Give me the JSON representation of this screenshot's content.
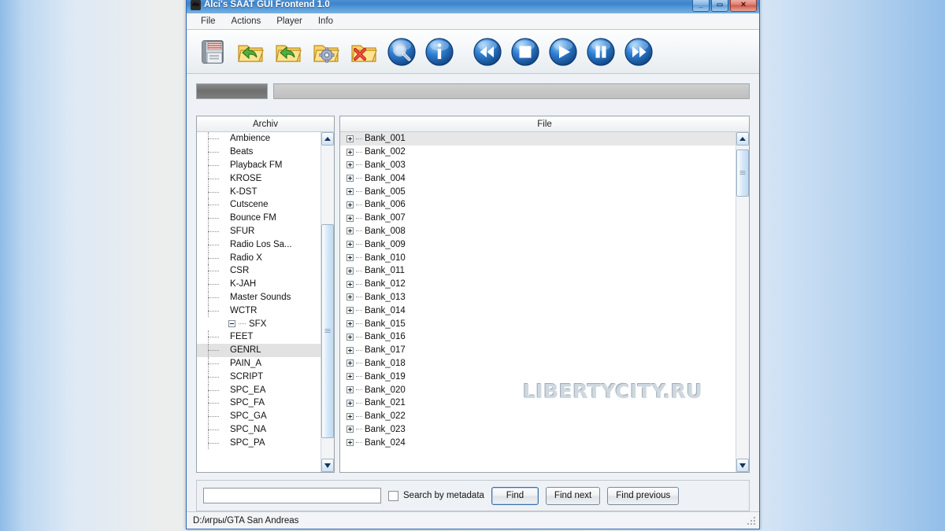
{
  "window": {
    "title": "Alci's SAAT GUI Frontend 1.0",
    "icon": "app-icon",
    "buttons": [
      {
        "name": "minimize",
        "glyph": "_"
      },
      {
        "name": "maximize",
        "glyph": "▭"
      },
      {
        "name": "close",
        "glyph": "✕"
      }
    ]
  },
  "menubar": {
    "items": [
      {
        "label": "File"
      },
      {
        "label": "Actions"
      },
      {
        "label": "Player"
      },
      {
        "label": "Info"
      }
    ]
  },
  "toolbar": {
    "buttons": [
      {
        "name": "save-button",
        "icon": "floppy-disk-icon",
        "tip": "Save"
      },
      {
        "name": "open-archive-button",
        "icon": "folder-open-icon",
        "tip": "Open archive"
      },
      {
        "name": "import-folder-button",
        "icon": "folder-import-icon",
        "tip": "Import folder"
      },
      {
        "name": "folder-settings-button",
        "icon": "folder-gear-icon",
        "tip": "Folder options"
      },
      {
        "name": "delete-folder-button",
        "icon": "folder-delete-icon",
        "tip": "Delete"
      },
      {
        "name": "search-button",
        "icon": "magnifier-icon",
        "tip": "Search"
      },
      {
        "name": "info-button",
        "icon": "info-icon",
        "tip": "Info"
      },
      {
        "name": "rewind-button",
        "icon": "rewind-icon",
        "tip": "Rewind"
      },
      {
        "name": "stop-button",
        "icon": "stop-icon",
        "tip": "Stop"
      },
      {
        "name": "play-button",
        "icon": "play-icon",
        "tip": "Play"
      },
      {
        "name": "pause-button",
        "icon": "pause-icon",
        "tip": "Pause"
      },
      {
        "name": "fastforward-button",
        "icon": "fast-forward-icon",
        "tip": "Fast forward"
      }
    ]
  },
  "progress": {
    "small": {
      "percent": 100
    },
    "large": {
      "percent": 100
    }
  },
  "tree": {
    "header": "Archiv",
    "selected": "GENRL",
    "items": [
      {
        "label": "Ambience",
        "level": 2,
        "type": "leaf"
      },
      {
        "label": "Beats",
        "level": 2,
        "type": "leaf"
      },
      {
        "label": "Playback FM",
        "level": 2,
        "type": "leaf"
      },
      {
        "label": "KROSE",
        "level": 2,
        "type": "leaf"
      },
      {
        "label": "K-DST",
        "level": 2,
        "type": "leaf"
      },
      {
        "label": "Cutscene",
        "level": 2,
        "type": "leaf"
      },
      {
        "label": "Bounce FM",
        "level": 2,
        "type": "leaf"
      },
      {
        "label": "SFUR",
        "level": 2,
        "type": "leaf"
      },
      {
        "label": "Radio Los Sa...",
        "level": 2,
        "type": "leaf"
      },
      {
        "label": "Radio X",
        "level": 2,
        "type": "leaf"
      },
      {
        "label": "CSR",
        "level": 2,
        "type": "leaf"
      },
      {
        "label": "K-JAH",
        "level": 2,
        "type": "leaf"
      },
      {
        "label": "Master Sounds",
        "level": 2,
        "type": "leaf"
      },
      {
        "label": "WCTR",
        "level": 2,
        "type": "leaf"
      },
      {
        "label": "SFX",
        "level": 1,
        "type": "expanded"
      },
      {
        "label": "FEET",
        "level": 2,
        "type": "leaf"
      },
      {
        "label": "GENRL",
        "level": 2,
        "type": "leaf"
      },
      {
        "label": "PAIN_A",
        "level": 2,
        "type": "leaf"
      },
      {
        "label": "SCRIPT",
        "level": 2,
        "type": "leaf"
      },
      {
        "label": "SPC_EA",
        "level": 2,
        "type": "leaf"
      },
      {
        "label": "SPC_FA",
        "level": 2,
        "type": "leaf"
      },
      {
        "label": "SPC_GA",
        "level": 2,
        "type": "leaf"
      },
      {
        "label": "SPC_NA",
        "level": 2,
        "type": "leaf"
      },
      {
        "label": "SPC_PA",
        "level": 2,
        "type": "leaf"
      }
    ],
    "scrollbar": {
      "thumb_top_pct": 27,
      "thumb_height_pct": 63
    }
  },
  "files": {
    "header": "File",
    "selected": "Bank_001",
    "items": [
      {
        "label": "Bank_001"
      },
      {
        "label": "Bank_002"
      },
      {
        "label": "Bank_003"
      },
      {
        "label": "Bank_004"
      },
      {
        "label": "Bank_005"
      },
      {
        "label": "Bank_006"
      },
      {
        "label": "Bank_007"
      },
      {
        "label": "Bank_008"
      },
      {
        "label": "Bank_009"
      },
      {
        "label": "Bank_010"
      },
      {
        "label": "Bank_011"
      },
      {
        "label": "Bank_012"
      },
      {
        "label": "Bank_013"
      },
      {
        "label": "Bank_014"
      },
      {
        "label": "Bank_015"
      },
      {
        "label": "Bank_016"
      },
      {
        "label": "Bank_017"
      },
      {
        "label": "Bank_018"
      },
      {
        "label": "Bank_019"
      },
      {
        "label": "Bank_020"
      },
      {
        "label": "Bank_021"
      },
      {
        "label": "Bank_022"
      },
      {
        "label": "Bank_023"
      },
      {
        "label": "Bank_024"
      }
    ],
    "scrollbar": {
      "thumb_top_pct": 5,
      "thumb_height_pct": 14
    }
  },
  "watermark": {
    "text": "LIBERTYCITY.RU"
  },
  "search": {
    "value": "",
    "placeholder": "",
    "metadata_label": "Search by metadata",
    "metadata_checked": false,
    "find_label": "Find",
    "find_next_label": "Find next",
    "find_previous_label": "Find previous"
  },
  "statusbar": {
    "path": "D:/игры/GTA San Andreas"
  },
  "colors": {
    "titlebar": "#3e84cc",
    "accent": "#2f6dbb",
    "selection": "#e2e2e2",
    "pane_bg": "#ffffff"
  }
}
